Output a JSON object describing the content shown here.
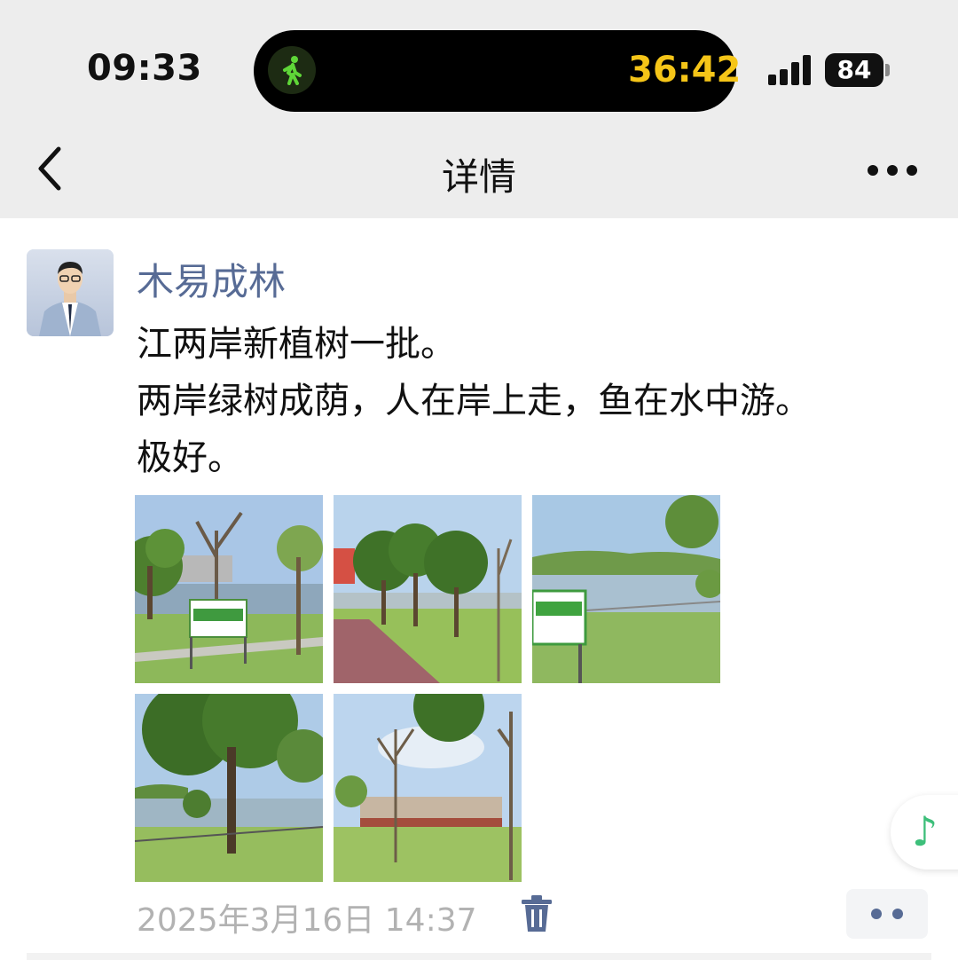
{
  "status_bar": {
    "time": "09:33",
    "activity_timer": "36:42",
    "battery_percent": "84",
    "activity_icon": "walking-icon"
  },
  "nav": {
    "title": "详情",
    "back_icon": "chevron-left-icon",
    "more_icon": "more-icon"
  },
  "post": {
    "author": "木易成林",
    "lines": [
      "江两岸新植树一批。",
      "两岸绿树成荫，人在岸上走，鱼在水中游。",
      "极好。"
    ],
    "photos": [
      {
        "name": "riverside-trees-sign-1"
      },
      {
        "name": "trees-along-path"
      },
      {
        "name": "river-view-sign-2"
      },
      {
        "name": "big-tree-riverbank"
      },
      {
        "name": "young-trees-building"
      }
    ],
    "timestamp": "2025年3月16日 14:37",
    "delete_icon": "trash-icon",
    "actions_icon": "two-dots-icon"
  },
  "floating": {
    "music_icon": "music-note-icon"
  },
  "colors": {
    "link_blue": "#576b95",
    "timer_yellow": "#f5c518",
    "music_green": "#3dbf7a",
    "header_gray": "#ededed"
  }
}
